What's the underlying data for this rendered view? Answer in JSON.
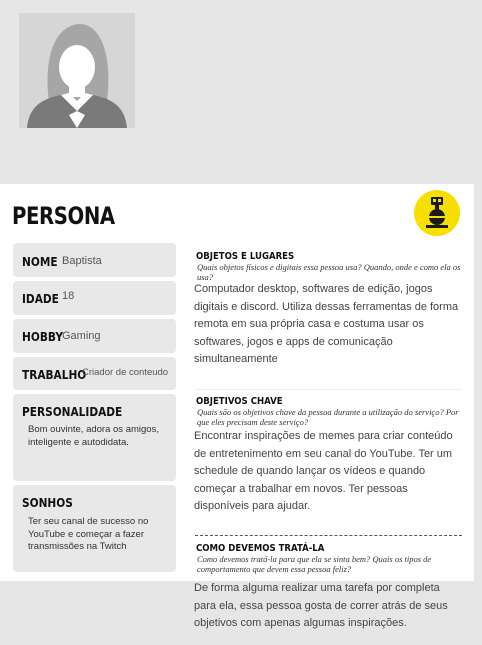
{
  "header": {
    "title": "PERSONA"
  },
  "profile": {
    "name_label": "NOME",
    "name_value": "Baptista",
    "age_label": "IDADE",
    "age_value": "18",
    "hobby_label": "HOBBY",
    "hobby_value": "Gaming",
    "job_label": "TRABALHO",
    "job_value": "Criador de conteudo",
    "personality_label": "PERSONALIDADE",
    "personality_desc": "Bom ouvinte, adora os amigos, inteligente e autodidata.",
    "dreams_label": "SONHOS",
    "dreams_desc": "Ter seu canal de sucesso no YouTube e começar a fazer transmissões na Twitch"
  },
  "sections": {
    "objects": {
      "heading": "OBJETOS E LUGARES",
      "question": "Quais objetos físicos e digitais essa pessoa usa? Quando, onde e como ela os usa?",
      "body": "Computador desktop, softwares de edição, jogos digitais e discord. Utiliza dessas ferramentas de forma remota em sua própria casa e costuma usar os softwares, jogos e apps de comunicação simultaneamente"
    },
    "goals": {
      "heading": "OBJETIVOS CHAVE",
      "question": "Quais são os objetivos chave da pessoa durante a utilização do serviço? Por que eles precisam deste serviço?",
      "body": "Encontrar inspirações de memes para criar conteúdo de entretenimento em seu canal do YouTube. Ter um schedule de quando lançar os vídeos e quando começar a trabalhar em novos. Ter pessoas disponíveis para ajudar."
    },
    "treatment": {
      "heading": "COMO DEVEMOS TRATÁ-LA",
      "question": "Como devemos tratá-la para que ela se sinta bem? Quais os tipos de comportamento que devem essa pessoa feliz?",
      "body": "De forma alguma realizar uma tarefa por completa para ela, essa pessoa gosta de correr atrás de seus objetivos com apenas algumas inspirações."
    }
  },
  "colors": {
    "logo_bg": "#f7e000",
    "field_bg": "#e8e8e8",
    "card_bg": "#ffffff",
    "page_bg": "#e6e6e6"
  },
  "icons": {
    "avatar": "person-silhouette-icon",
    "logo": "robot-logo-icon"
  }
}
